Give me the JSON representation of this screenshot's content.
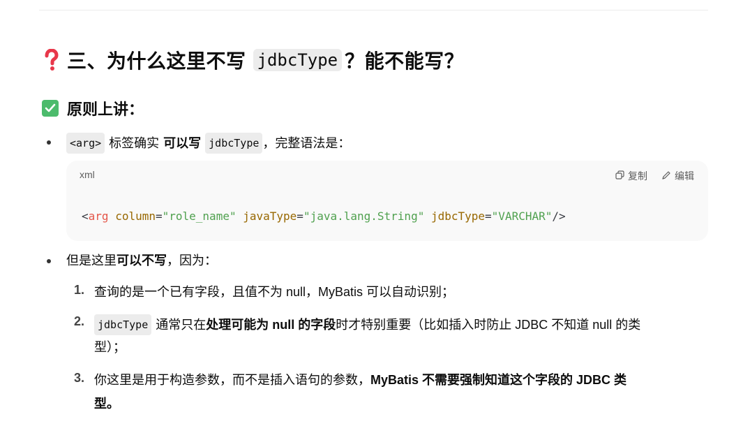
{
  "heading3": {
    "icon": "question-mark-icon",
    "text_before": "三、为什么这里不写",
    "code": "jdbcType",
    "text_after": "？能不能写？"
  },
  "heading4": {
    "icon": "check-box-icon",
    "text": "原则上讲："
  },
  "bullet1": {
    "code1": "<arg>",
    "text1": "标签确实",
    "bold": "可以写",
    "code2": "jdbcType",
    "text2": "，完整语法是："
  },
  "codeblock": {
    "language": "xml",
    "copy_label": "复制",
    "edit_label": "编辑",
    "lt": "<",
    "tag": "arg",
    "attr1": "column",
    "val1": "\"role_name\"",
    "attr2": "javaType",
    "val2": "\"java.lang.String\"",
    "attr3": "jdbcType",
    "val3": "\"VARCHAR\"",
    "end": "/>",
    "eq": "="
  },
  "bullet2": {
    "text1": "但是这里",
    "bold": "可以不写",
    "text2": "，因为："
  },
  "list": [
    {
      "number": "1.",
      "text": "查询的是一个已有字段，且值不为 null，MyBatis 可以自动识别；"
    },
    {
      "number": "2.",
      "code": "jdbcType",
      "text1": "通常只在",
      "bold": "处理可能为 null 的字段",
      "text2": "时才特别重要（比如插入时防止 JDBC 不知道 null 的类",
      "text3": "型）；"
    },
    {
      "number": "3.",
      "text1": "你这里是用于构造参数，而不是插入语句的参数，",
      "bold1": "MyBatis 不需要强制知道这个字段的 JDBC 类",
      "bold2": "型。"
    }
  ]
}
